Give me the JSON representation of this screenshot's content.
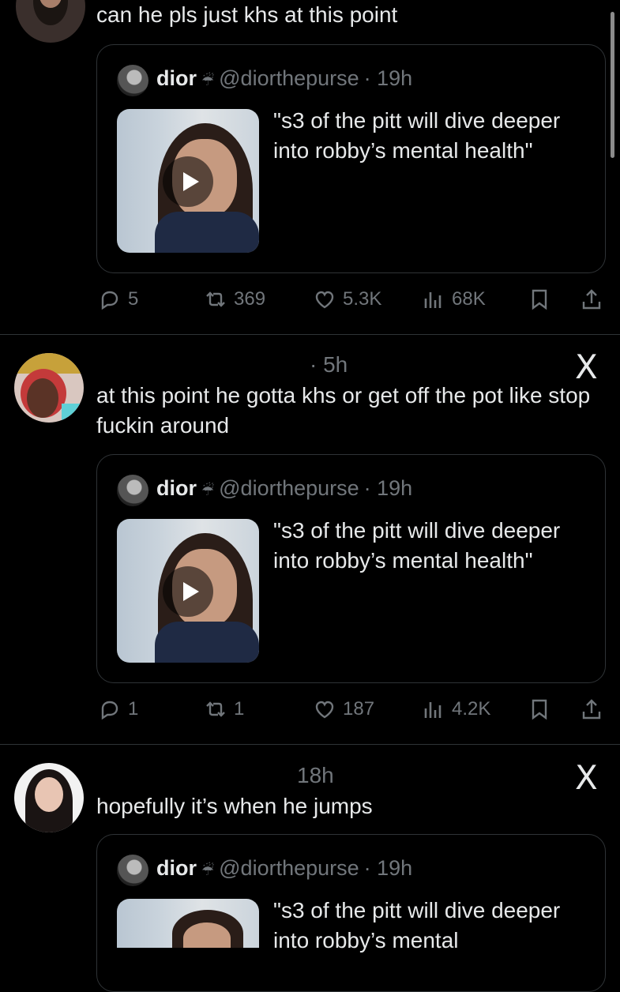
{
  "posts": [
    {
      "text": "can he pls just khs at this point",
      "time": "",
      "quote": {
        "name": "dior",
        "badge": "☔",
        "handle": "@diorthepurse",
        "time": "· 19h",
        "text": "\"s3 of the pitt will dive deeper into robby’s mental health\""
      },
      "stats": {
        "replies": "5",
        "reposts": "369",
        "likes": "5.3K",
        "views": "68K"
      }
    },
    {
      "text": "at this point he gotta khs or get off the pot like stop fuckin around",
      "time": "· 5h",
      "quote": {
        "name": "dior",
        "badge": "☔",
        "handle": "@diorthepurse",
        "time": "· 19h",
        "text": "\"s3 of the pitt will dive deeper into robby’s mental health\""
      },
      "stats": {
        "replies": "1",
        "reposts": "1",
        "likes": "187",
        "views": "4.2K"
      }
    },
    {
      "text": "hopefully it’s when he jumps",
      "time": "18h",
      "quote": {
        "name": "dior",
        "badge": "☔",
        "handle": "@diorthepurse",
        "time": "· 19h",
        "text": "\"s3 of the pitt will dive deeper into robby’s mental"
      }
    }
  ],
  "icons": {
    "reply": "reply-icon",
    "repost": "repost-icon",
    "like": "heart-icon",
    "views": "views-icon",
    "bookmark": "bookmark-icon",
    "share": "share-icon",
    "close": "x-close-icon"
  },
  "x_mark": "X",
  "colors": {
    "background": "#000000",
    "text": "#e7e9ea",
    "muted": "#71767b",
    "border": "#2f3336"
  }
}
